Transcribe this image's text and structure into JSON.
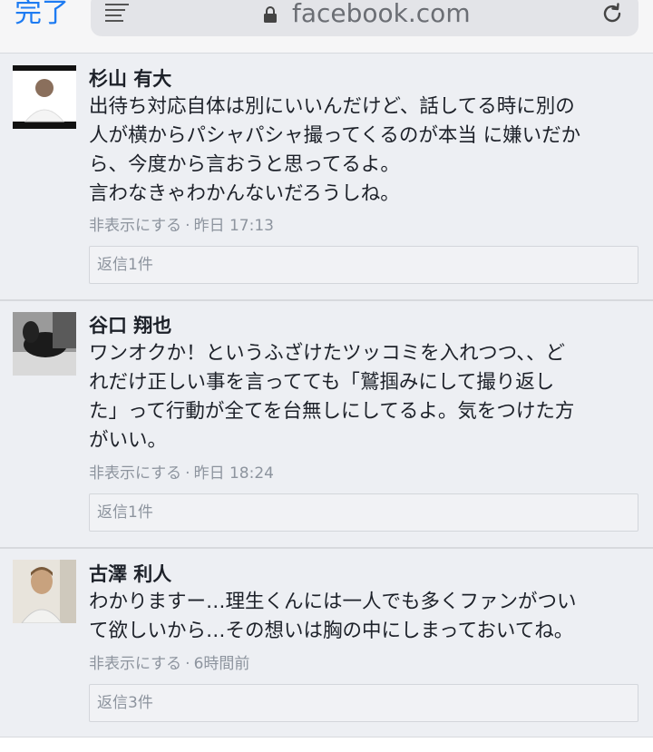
{
  "browser": {
    "done_label": "完了",
    "url": "facebook.com"
  },
  "comments": [
    {
      "name": "杉山 有大",
      "text": "出待ち対応自体は別にいいんだけど、話してる時に別の\n人が横からパシャパシャ撮ってくるのが本当 に嫌いだか\nら、今度から言おうと思ってるよ。\n言わなきゃわかんないだろうしね。",
      "hide_label": "非表示にする",
      "separator": "·",
      "time": "昨日 17:13",
      "reply_label": "返信1件"
    },
    {
      "name": "谷口 翔也",
      "text": "ワンオクか！というふざけたツッコミを入れつつ、、ど\nれだけ正しい事を言ってても「鷲掴みにして撮り返し\nた」って行動が全てを台無しにしてるよ。気をつけた方\nがいい。",
      "hide_label": "非表示にする",
      "separator": "·",
      "time": "昨日 18:24",
      "reply_label": "返信1件"
    },
    {
      "name": "古澤 利人",
      "text": "わかりますー…理生くんには一人でも多くファンがつい\nて欲しいから…その想いは胸の中にしまっておいてね。",
      "hide_label": "非表示にする",
      "separator": "·",
      "time": "6時間前",
      "reply_label": "返信3件"
    }
  ],
  "colors": {
    "accent": "#1d7bf2",
    "meta": "#8d949e",
    "background": "#edeff3"
  }
}
